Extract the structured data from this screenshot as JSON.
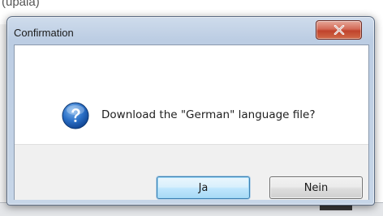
{
  "background": {
    "partial_text": "(upala)"
  },
  "dialog": {
    "title": "Confirmation",
    "close_icon": "close-icon",
    "message": "Download the \"German\" language file?",
    "message_icon": "question-icon",
    "buttons": {
      "yes_label": "Ja",
      "no_label": "Nein"
    }
  },
  "colors": {
    "close_button": "#c0432c",
    "question_icon": "#1b5fb3",
    "default_button_border": "#3c7fb1"
  }
}
